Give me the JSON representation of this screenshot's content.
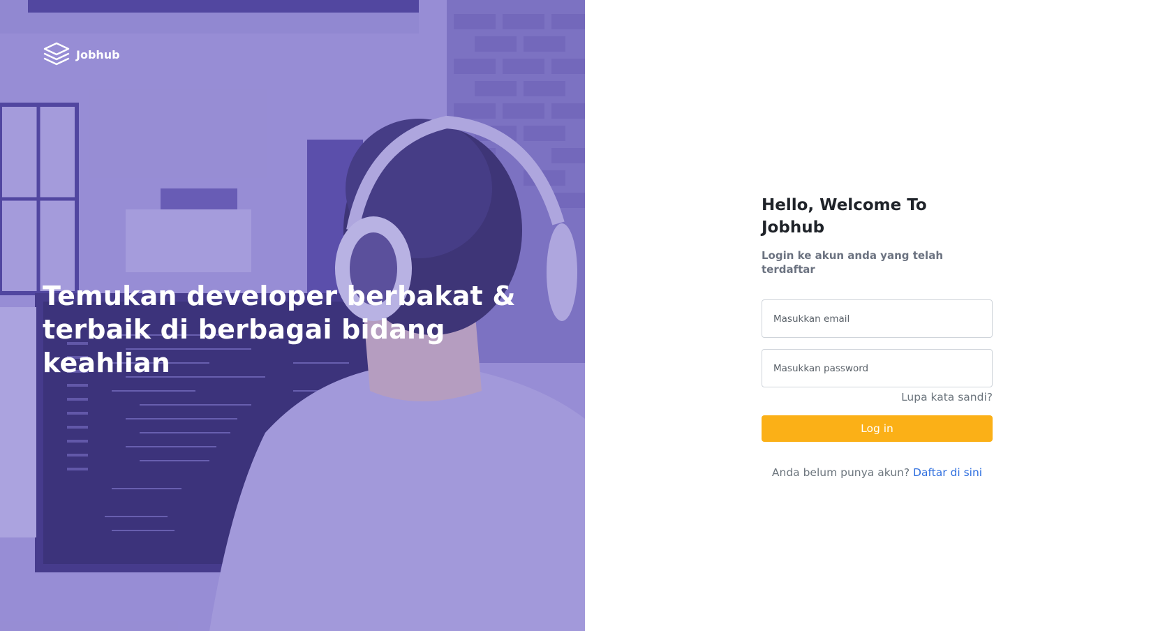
{
  "brand": {
    "name": "Jobhub",
    "icon": "stacked-layers-icon"
  },
  "hero": {
    "headline_line1": "Temukan developer berbakat &",
    "headline_line2": "terbaik di berbagai bidang keahlian",
    "overlay_color": "#5e50bf"
  },
  "login": {
    "title": "Hello, Welcome To Jobhub",
    "subtitle": "Login ke akun anda yang telah terdaftar",
    "email_placeholder": "Masukkan email",
    "password_placeholder": "Masukkan password",
    "forgot_label": "Lupa kata sandi?",
    "submit_label": "Log in",
    "register_prompt": "Anda belum punya akun?",
    "register_link": "Daftar di sini",
    "accent_color": "#fbb017",
    "link_color": "#2f6fdf"
  }
}
